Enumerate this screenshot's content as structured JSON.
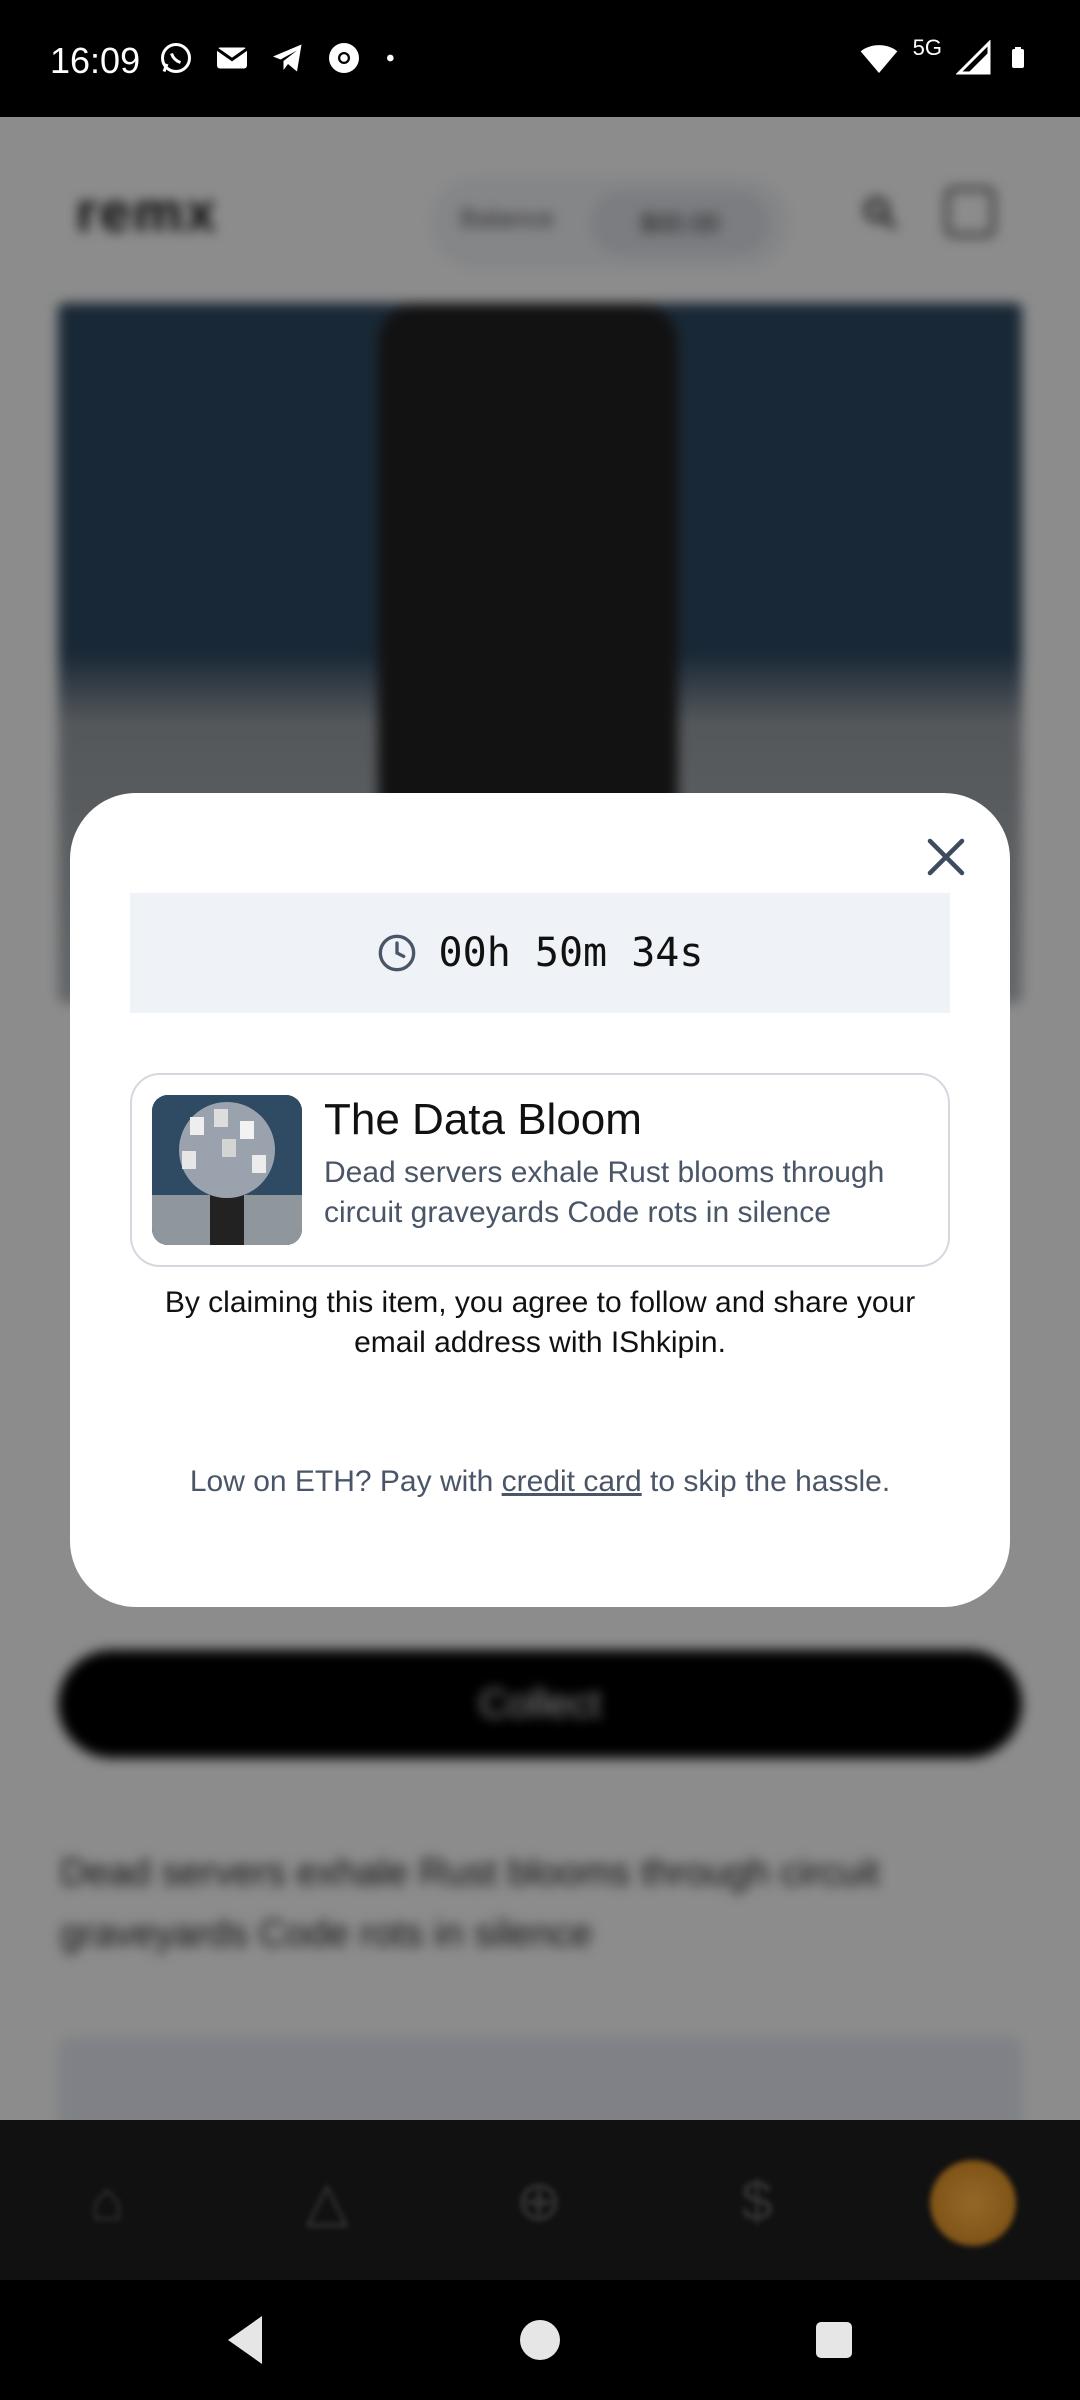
{
  "status_bar": {
    "time": "16:09",
    "notification_icons": [
      "whatsapp-icon",
      "gmail-icon",
      "telegram-icon",
      "chrome-icon",
      "dot-icon"
    ],
    "network_label": "5G",
    "system_icons": [
      "wifi-icon",
      "signal-icon",
      "battery-icon"
    ]
  },
  "app_background": {
    "logo_text": "remx",
    "header_pill_a": "Balance",
    "header_pill_b": "$00.00",
    "collect_button_label": "Collect",
    "description": "Dead servers exhale Rust blooms through circuit graveyards Code rots in silence"
  },
  "modal": {
    "timer": "00h 50m 34s",
    "item": {
      "title": "The Data Bloom",
      "description": "Dead servers exhale Rust blooms through circuit graveyards Code rots in silence"
    },
    "agreement_text": "By claiming this item, you agree to follow and share your email address with IShkipin.",
    "low_eth_prefix": "Low on ETH? Pay with ",
    "low_eth_link": "credit card",
    "low_eth_suffix": " to skip the hassle."
  },
  "colors": {
    "modal_bg": "#ffffff",
    "timer_bg": "#eff2f7",
    "secondary_text": "#4a5668",
    "accent_avatar": "#ffb03a"
  }
}
